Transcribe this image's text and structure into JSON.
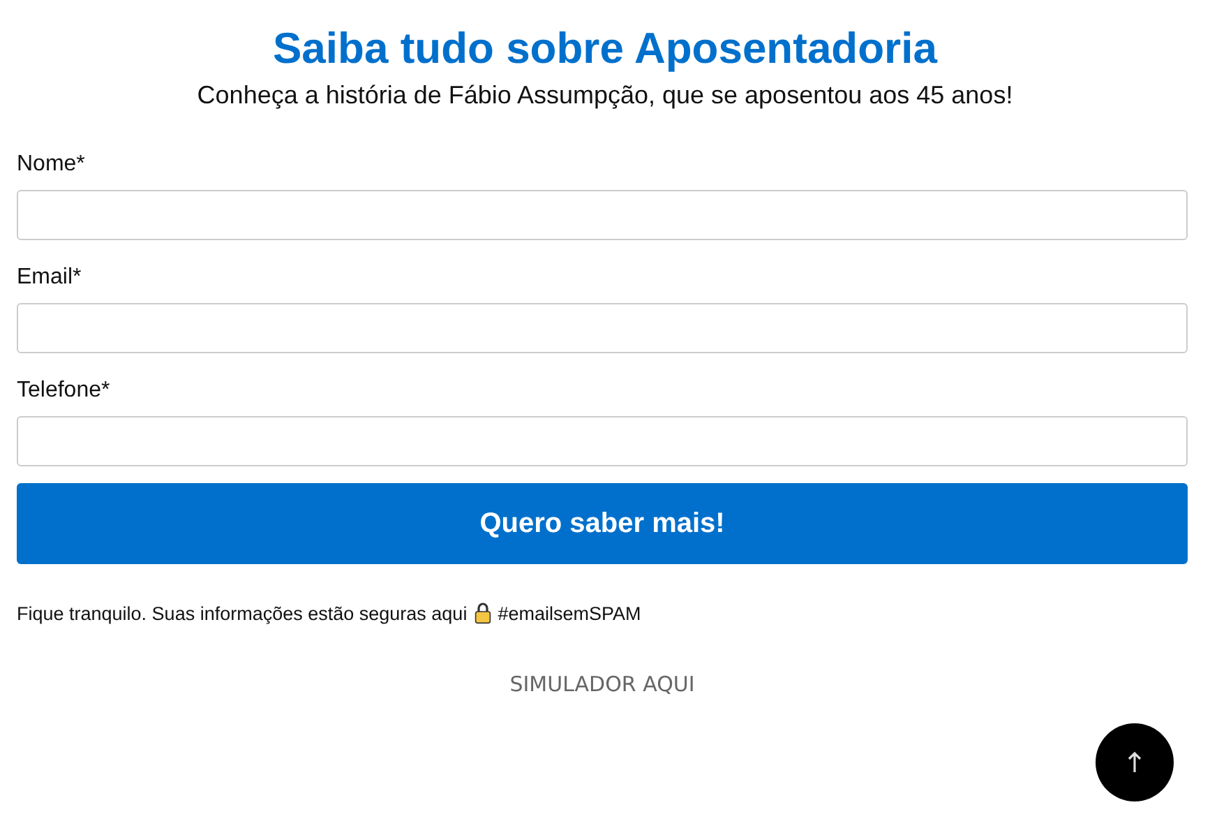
{
  "title": "Saiba tudo sobre Aposentadoria",
  "subtitle": "Conheça a história de Fábio Assumpção, que se aposentou aos 45 anos!",
  "fields": [
    {
      "label": "Nome*"
    },
    {
      "label": "Email*"
    },
    {
      "label": "Telefone*"
    }
  ],
  "submit": "Quero saber mais!",
  "note": {
    "before": "Fique tranquilo. Suas informações estão seguras aqui",
    "after": "#emailsemSPAM"
  },
  "link": "SIMULADOR AQUI"
}
